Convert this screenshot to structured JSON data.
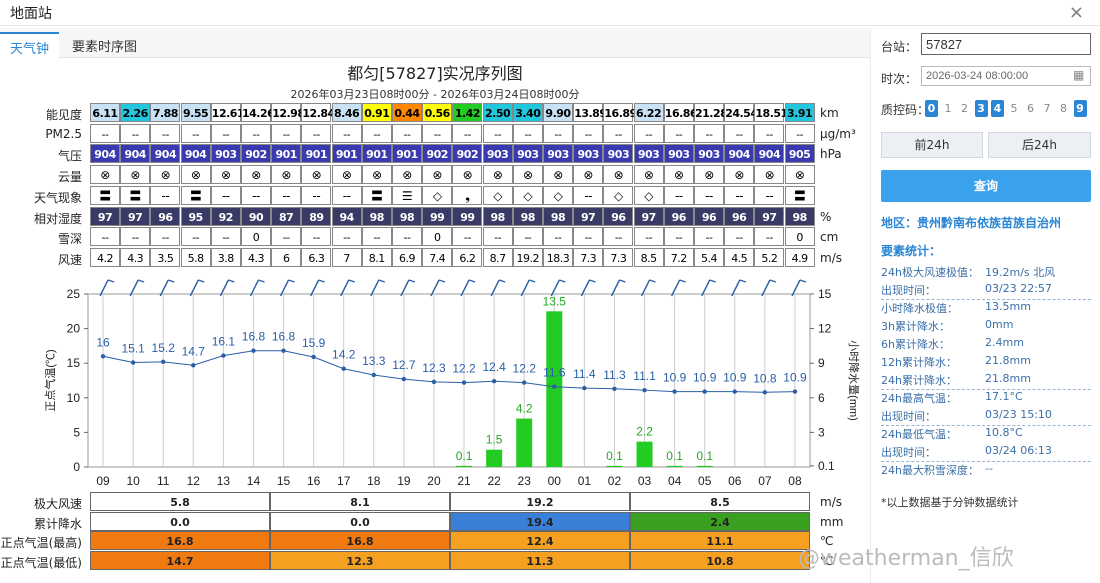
{
  "window": {
    "title": "地面站",
    "close": "×"
  },
  "tabs": [
    {
      "label": "天气钟",
      "active": true
    },
    {
      "label": "要素时序图",
      "active": false
    }
  ],
  "chart": {
    "title": "都匀[57827]实况序列图",
    "subtitle": "2026年03月23日08时00分 - 2026年03月24日08时00分"
  },
  "hours": [
    "09",
    "10",
    "11",
    "12",
    "13",
    "14",
    "15",
    "16",
    "17",
    "18",
    "19",
    "20",
    "21",
    "22",
    "23",
    "00",
    "01",
    "02",
    "03",
    "04",
    "05",
    "06",
    "07",
    "08"
  ],
  "rows": [
    {
      "label": "能见度",
      "unit": "km",
      "style": "vis",
      "values": [
        "6.11",
        "2.26",
        "7.88",
        "9.55",
        "12.61",
        "14.26",
        "12.98",
        "12.84",
        "8.46",
        "0.91",
        "0.44",
        "0.56",
        "1.42",
        "2.50",
        "3.40",
        "9.90",
        "13.89",
        "16.89",
        "6.22",
        "16.86",
        "21.28",
        "24.54",
        "18.51",
        "3.91"
      ],
      "colors": [
        "#c8e1f5",
        "#22c6dd",
        "#c8e1f5",
        "#c8e1f5",
        "#fff",
        "#fff",
        "#fff",
        "#fff",
        "#c8e1f5",
        "#ffff00",
        "#ff8800",
        "#ffff00",
        "#22cc22",
        "#22c6dd",
        "#22c6dd",
        "#c8e1f5",
        "#fff",
        "#fff",
        "#c8e1f5",
        "#fff",
        "#fff",
        "#fff",
        "#fff",
        "#22c6dd"
      ]
    },
    {
      "label": "PM2.5",
      "unit": "μg/m³",
      "style": "plain",
      "values": [
        "--",
        "--",
        "--",
        "--",
        "--",
        "--",
        "--",
        "--",
        "--",
        "--",
        "--",
        "--",
        "--",
        "--",
        "--",
        "--",
        "--",
        "--",
        "--",
        "--",
        "--",
        "--",
        "--",
        "--"
      ]
    },
    {
      "label": "气压",
      "unit": "hPa",
      "style": "dark",
      "values": [
        "904",
        "904",
        "904",
        "904",
        "903",
        "902",
        "901",
        "901",
        "901",
        "901",
        "901",
        "902",
        "902",
        "903",
        "903",
        "903",
        "903",
        "903",
        "903",
        "903",
        "903",
        "904",
        "904",
        "905"
      ]
    },
    {
      "label": "云量",
      "unit": "",
      "style": "sym",
      "values": [
        "⊗",
        "⊗",
        "⊗",
        "⊗",
        "⊗",
        "⊗",
        "⊗",
        "⊗",
        "⊗",
        "⊗",
        "⊗",
        "⊗",
        "⊗",
        "⊗",
        "⊗",
        "⊗",
        "⊗",
        "⊗",
        "⊗",
        "⊗",
        "⊗",
        "⊗",
        "⊗",
        "⊗"
      ]
    },
    {
      "label": "天气现象",
      "unit": "",
      "style": "sym",
      "values": [
        "〓",
        "〓",
        "--",
        "〓",
        "--",
        "--",
        "--",
        "--",
        "--",
        "〓",
        "☰",
        "◇",
        "❟",
        "◇",
        "◇",
        "◇",
        "--",
        "◇",
        "◇",
        "--",
        "--",
        "--",
        "--",
        "〓"
      ]
    },
    {
      "label": "相对湿度",
      "unit": "%",
      "style": "rh",
      "values": [
        "97",
        "97",
        "96",
        "95",
        "92",
        "90",
        "87",
        "89",
        "94",
        "98",
        "98",
        "99",
        "99",
        "98",
        "98",
        "98",
        "97",
        "96",
        "97",
        "96",
        "96",
        "96",
        "97",
        "98"
      ]
    },
    {
      "label": "雪深",
      "unit": "cm",
      "style": "plain",
      "values": [
        "--",
        "--",
        "--",
        "--",
        "--",
        "0",
        "--",
        "--",
        "--",
        "--",
        "--",
        "0",
        "--",
        "--",
        "--",
        "--",
        "--",
        "--",
        "--",
        "--",
        "--",
        "--",
        "--",
        "0"
      ]
    },
    {
      "label": "风速",
      "unit": "m/s",
      "style": "plain",
      "values": [
        "4.2",
        "4.3",
        "3.5",
        "5.8",
        "3.8",
        "4.3",
        "6",
        "6.3",
        "7",
        "8.1",
        "6.9",
        "7.4",
        "6.2",
        "8.7",
        "19.2",
        "18.3",
        "7.3",
        "7.3",
        "8.5",
        "7.2",
        "5.4",
        "4.5",
        "5.2",
        "4.9"
      ]
    }
  ],
  "axis": {
    "left_label": "正点气温(℃)",
    "right_label": "小时降水量(mm)",
    "left_ticks": [
      "0",
      "5",
      "10",
      "15",
      "20",
      "25"
    ],
    "right_ticks": [
      "0.1",
      "3",
      "6",
      "9",
      "12",
      "15"
    ]
  },
  "chart_data": {
    "type": "line+bar",
    "x": [
      "09",
      "10",
      "11",
      "12",
      "13",
      "14",
      "15",
      "16",
      "17",
      "18",
      "19",
      "20",
      "21",
      "22",
      "23",
      "00",
      "01",
      "02",
      "03",
      "04",
      "05",
      "06",
      "07",
      "08"
    ],
    "temperature": [
      16,
      15.1,
      15.2,
      14.7,
      16.1,
      16.8,
      16.8,
      15.9,
      14.2,
      13.3,
      12.7,
      12.3,
      12.2,
      12.4,
      12.2,
      11.6,
      11.4,
      11.3,
      11.1,
      10.9,
      10.9,
      10.9,
      10.8,
      10.9
    ],
    "precip": [
      null,
      null,
      null,
      null,
      null,
      null,
      null,
      null,
      null,
      null,
      null,
      null,
      0.1,
      1.5,
      4.2,
      13.5,
      null,
      0.1,
      2.2,
      0.1,
      0.1,
      null,
      null,
      null
    ],
    "ylim_left": [
      0,
      25
    ],
    "ylim_right": [
      0,
      15
    ]
  },
  "bottom": [
    {
      "label": "极大风速",
      "unit": "m/s",
      "cells": [
        {
          "v": "5.8",
          "bg": "#fff"
        },
        {
          "v": "8.1",
          "bg": "#fff"
        },
        {
          "v": "19.2",
          "bg": "#fff"
        },
        {
          "v": "8.5",
          "bg": "#fff"
        }
      ]
    },
    {
      "label": "累计降水",
      "unit": "mm",
      "cells": [
        {
          "v": "0.0",
          "bg": "#fff"
        },
        {
          "v": "0.0",
          "bg": "#fff"
        },
        {
          "v": "19.4",
          "bg": "#3a80d8"
        },
        {
          "v": "2.4",
          "bg": "#3aa020"
        }
      ]
    },
    {
      "label": "正点气温(最高)",
      "unit": "℃",
      "cells": [
        {
          "v": "16.8",
          "bg": "#f07a10"
        },
        {
          "v": "16.8",
          "bg": "#f07a10"
        },
        {
          "v": "12.4",
          "bg": "#f5a020"
        },
        {
          "v": "11.1",
          "bg": "#f5a020"
        }
      ]
    },
    {
      "label": "正点气温(最低)",
      "unit": "℃",
      "cells": [
        {
          "v": "14.7",
          "bg": "#f07a10"
        },
        {
          "v": "12.3",
          "bg": "#f5a020"
        },
        {
          "v": "11.3",
          "bg": "#f5a020"
        },
        {
          "v": "10.8",
          "bg": "#f5a020"
        }
      ]
    }
  ],
  "panel": {
    "station_label": "台站：",
    "station_value": "57827",
    "time_label": "时次：",
    "time_value": "2026-03-24 08:00:00",
    "qc_label": "质控码：",
    "qc": [
      {
        "v": "0",
        "on": true
      },
      {
        "v": "1",
        "on": false
      },
      {
        "v": "2",
        "on": false
      },
      {
        "v": "3",
        "on": true
      },
      {
        "v": "4",
        "on": true
      },
      {
        "v": "5",
        "on": false
      },
      {
        "v": "6",
        "on": false
      },
      {
        "v": "7",
        "on": false
      },
      {
        "v": "8",
        "on": false
      },
      {
        "v": "9",
        "on": true
      }
    ],
    "prev": "前24h",
    "next": "后24h",
    "query": "查询",
    "region": "地区：贵州黔南布依族苗族自治州",
    "stat_title": "要素统计：",
    "stats": [
      {
        "k": "24h极大风速极值：",
        "v": "19.2m/s 北风",
        "sep": false
      },
      {
        "k": "出现时间：",
        "v": "03/23 22:57",
        "sep": true
      },
      {
        "k": "小时降水极值：",
        "v": "13.5mm",
        "sep": false
      },
      {
        "k": "3h累计降水：",
        "v": "0mm",
        "sep": false
      },
      {
        "k": "6h累计降水：",
        "v": "2.4mm",
        "sep": false
      },
      {
        "k": "12h累计降水：",
        "v": "21.8mm",
        "sep": false
      },
      {
        "k": "24h累计降水：",
        "v": "21.8mm",
        "sep": true
      },
      {
        "k": "24h最高气温：",
        "v": "17.1°C",
        "sep": false
      },
      {
        "k": "出现时间：",
        "v": "03/23 15:10",
        "sep": true
      },
      {
        "k": "24h最低气温：",
        "v": "10.8°C",
        "sep": false
      },
      {
        "k": "出现时间：",
        "v": "03/24 06:13",
        "sep": true
      },
      {
        "k": "24h最大积雪深度：",
        "v": "--",
        "sep": false
      }
    ],
    "note": "*以上数据基于分钟数据统计"
  },
  "watermark": "@weatherman_信欣",
  "colors": {
    "line": "#2a5fa8",
    "bar": "#22cc22",
    "label": "#2a5fa8"
  }
}
